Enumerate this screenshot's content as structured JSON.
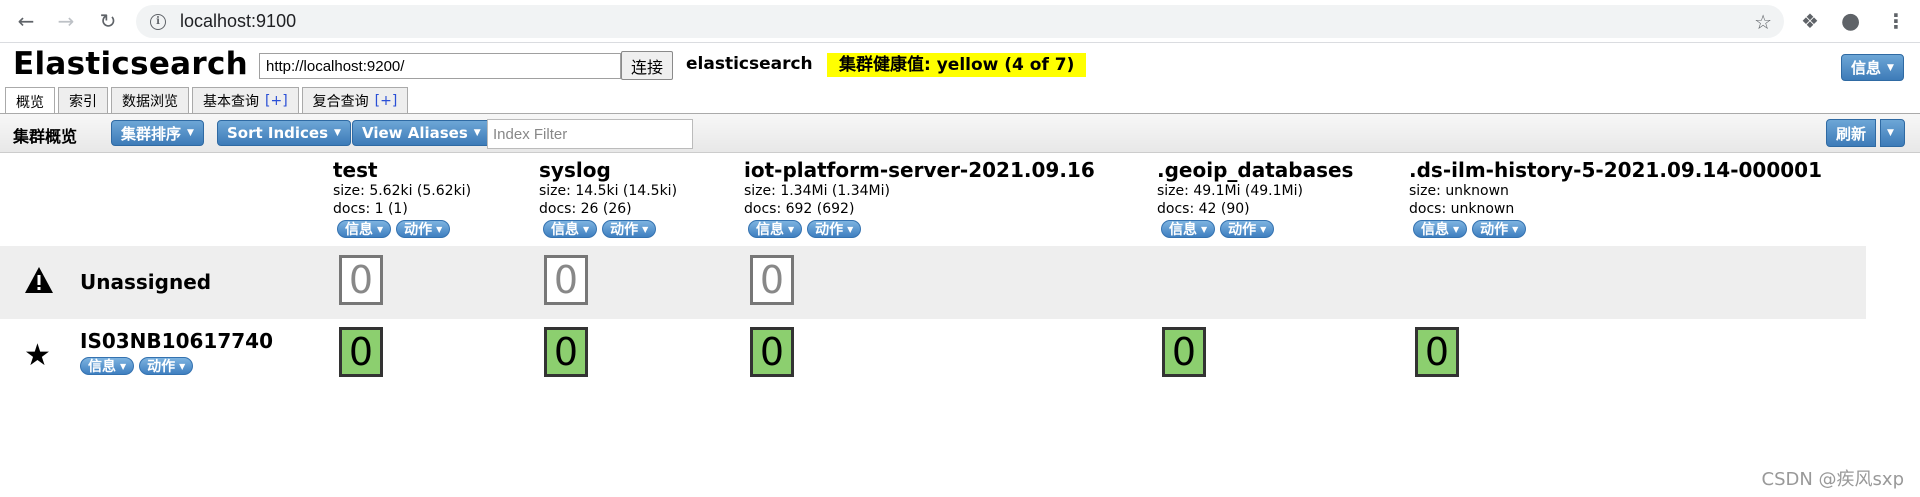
{
  "browser": {
    "url": "localhost:9100"
  },
  "header": {
    "title": "Elasticsearch",
    "connect_url": "http://localhost:9200/",
    "connect_label": "连接",
    "cluster_name": "elasticsearch",
    "health": "集群健康值: yellow (4 of 7)",
    "health_color": "#ffff00",
    "info_label": "信息"
  },
  "tabs": [
    {
      "label": "概览",
      "active": true
    },
    {
      "label": "索引"
    },
    {
      "label": "数据浏览"
    },
    {
      "label": "基本查询",
      "plus": "[+]"
    },
    {
      "label": "复合查询",
      "plus": "[+]"
    }
  ],
  "toolbar": {
    "title": "集群概览",
    "sort_cluster": "集群排序",
    "sort_indices": "Sort Indices",
    "view_aliases": "View Aliases",
    "filter_placeholder": "Index Filter",
    "refresh": "刷新"
  },
  "indices": [
    {
      "name": "test",
      "size": "size: 5.62ki (5.62ki)",
      "docs": "docs: 1 (1)"
    },
    {
      "name": "syslog",
      "size": "size: 14.5ki (14.5ki)",
      "docs": "docs: 26 (26)"
    },
    {
      "name": "iot-platform-server-2021.09.16",
      "size": "size: 1.34Mi (1.34Mi)",
      "docs": "docs: 692 (692)"
    },
    {
      "name": ".geoip_databases",
      "size": "size: 49.1Mi (49.1Mi)",
      "docs": "docs: 42 (90)"
    },
    {
      "name": ".ds-ilm-history-5-2021.09.14-000001",
      "size": "size: unknown",
      "docs": "docs: unknown"
    }
  ],
  "index_buttons": {
    "info": "信息",
    "action": "动作"
  },
  "rows": {
    "unassigned": {
      "label": "Unassigned",
      "shards": [
        "0",
        "0",
        "0"
      ]
    },
    "node": {
      "label": "IS03NB10617740",
      "info": "信息",
      "action": "动作",
      "shards": [
        "0",
        "0",
        "0",
        "0",
        "0"
      ]
    }
  },
  "colors": {
    "button_blue": "#3d7bb8",
    "shard_started": "#8ccf6f",
    "unassigned_row": "#eeeeee"
  },
  "watermark": "CSDN @疾风sxp"
}
